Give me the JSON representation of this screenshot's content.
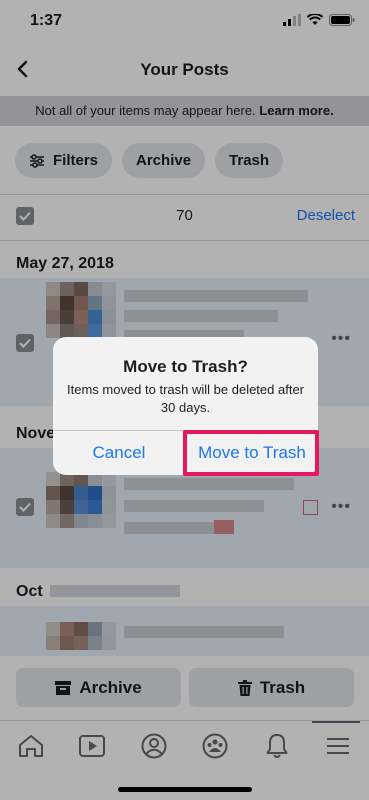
{
  "status": {
    "time": "1:37"
  },
  "nav": {
    "title": "Your Posts"
  },
  "notice": {
    "text": "Not all of your items may appear here.",
    "link": "Learn more."
  },
  "chips": {
    "filters": "Filters",
    "archive": "Archive",
    "trash": "Trash"
  },
  "selection": {
    "count": "70",
    "deselect": "Deselect"
  },
  "sections": {
    "date1": "May 27, 2018",
    "date2_partial": "Nove",
    "date3_partial": "Oct"
  },
  "dialog": {
    "title": "Move to Trash?",
    "message": "Items moved to trash will be deleted after 30 days.",
    "cancel": "Cancel",
    "confirm": "Move to Trash"
  },
  "actions": {
    "archive": "Archive",
    "trash": "Trash"
  },
  "tabs": [
    "home-icon",
    "video-icon",
    "profile-icon",
    "groups-icon",
    "notifications-icon",
    "menu-icon"
  ],
  "colors": {
    "accent": "#1877f2",
    "highlight": "#e5185e",
    "overlay": "rgba(0,0,0,0.30)"
  }
}
